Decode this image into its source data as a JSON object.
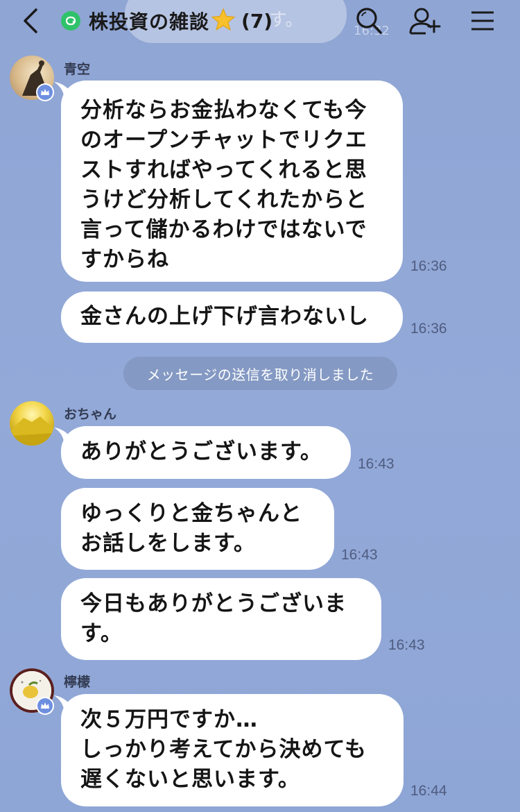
{
  "header": {
    "title": "株投資の雑談",
    "star": "⭐",
    "member_count": "(7)",
    "ghost_text": "す。",
    "ghost_time": "16:32"
  },
  "messages": [
    {
      "sender": "青空",
      "bubbles": [
        {
          "text": "分析ならお金払わなくても今\nのオープンチャットでリクエ\nストすればやってくれると思\nうけど分析してくれたからと\n言って儲かるわけではないで\nすからね",
          "time": "16:36"
        },
        {
          "text": "金さんの上げ下げ言わないし",
          "time": "16:36"
        }
      ]
    },
    {
      "system": "メッセージの送信を取り消しました"
    },
    {
      "sender": "おちゃん",
      "bubbles": [
        {
          "text": "ありがとうございます。",
          "time": "16:43"
        },
        {
          "text": "ゆっくりと金ちゃんと\nお話しをします。",
          "time": "16:43"
        },
        {
          "text": "今日もありがとうございま\nす。",
          "time": "16:43"
        }
      ]
    },
    {
      "sender": "檸檬",
      "bubbles": [
        {
          "text": "次５万円ですか…\nしっかり考えてから決めても\n遅くないと思います。",
          "time": "16:44"
        }
      ]
    }
  ],
  "colors": {
    "background": "#8fa5d4",
    "bubble": "#ffffff",
    "open_chat_green": "#2fc26a",
    "badge_blue": "#6e8fe0"
  },
  "icons": [
    "back-icon",
    "open-chat-icon",
    "search-icon",
    "add-friend-icon",
    "menu-icon",
    "crown-icon"
  ]
}
